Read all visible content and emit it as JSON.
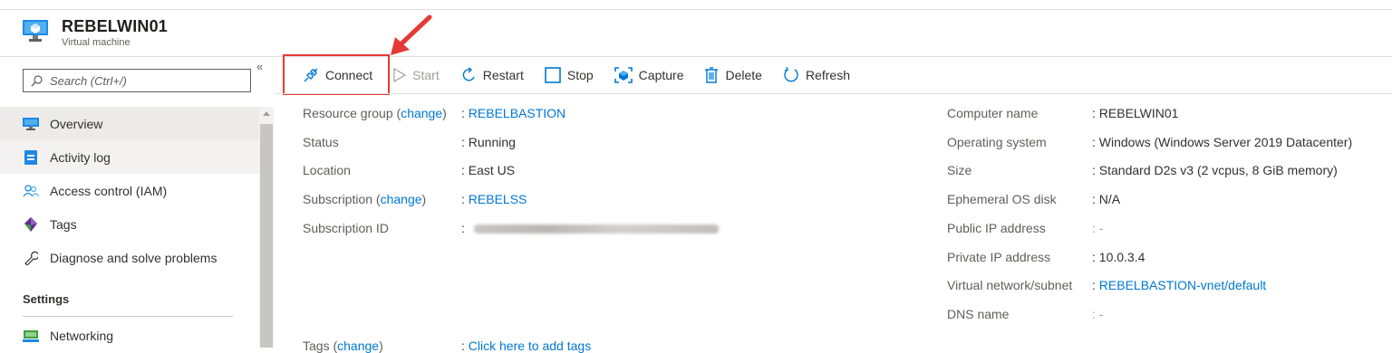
{
  "header": {
    "title": "REBELWIN01",
    "subtitle": "Virtual machine"
  },
  "sidebar": {
    "search_placeholder": "Search (Ctrl+/)",
    "collapse_glyph": "«",
    "items": [
      {
        "label": "Overview",
        "icon": "monitor-icon"
      },
      {
        "label": "Activity log",
        "icon": "activity-log-icon"
      },
      {
        "label": "Access control (IAM)",
        "icon": "people-icon"
      },
      {
        "label": "Tags",
        "icon": "tag-icon"
      },
      {
        "label": "Diagnose and solve problems",
        "icon": "wrench-icon"
      }
    ],
    "section_heading": "Settings",
    "settings_items": [
      {
        "label": "Networking",
        "icon": "networking-icon"
      }
    ]
  },
  "toolbar": {
    "connect": "Connect",
    "start": "Start",
    "restart": "Restart",
    "stop": "Stop",
    "capture": "Capture",
    "delete": "Delete",
    "refresh": "Refresh"
  },
  "essentials": {
    "change_link": "change",
    "left": {
      "resource_group_label": "Resource group",
      "resource_group_value": "REBELBASTION",
      "status_label": "Status",
      "status_value": "Running",
      "location_label": "Location",
      "location_value": "East US",
      "subscription_label": "Subscription",
      "subscription_value": "REBELSS",
      "subscription_id_label": "Subscription ID",
      "tags_label": "Tags",
      "tags_value": "Click here to add tags"
    },
    "right": {
      "computer_name_label": "Computer name",
      "computer_name_value": "REBELWIN01",
      "os_label": "Operating system",
      "os_value": "Windows (Windows Server 2019 Datacenter)",
      "size_label": "Size",
      "size_value": "Standard D2s v3 (2 vcpus, 8 GiB memory)",
      "ephemeral_label": "Ephemeral OS disk",
      "ephemeral_value": "N/A",
      "public_ip_label": "Public IP address",
      "public_ip_value": "-",
      "private_ip_label": "Private IP address",
      "private_ip_value": "10.0.3.4",
      "vnet_label": "Virtual network/subnet",
      "vnet_value": "REBELBASTION-vnet/default",
      "dns_label": "DNS name",
      "dns_value": "-"
    }
  },
  "colors": {
    "accent": "#0078d4",
    "highlight": "#e53935"
  }
}
